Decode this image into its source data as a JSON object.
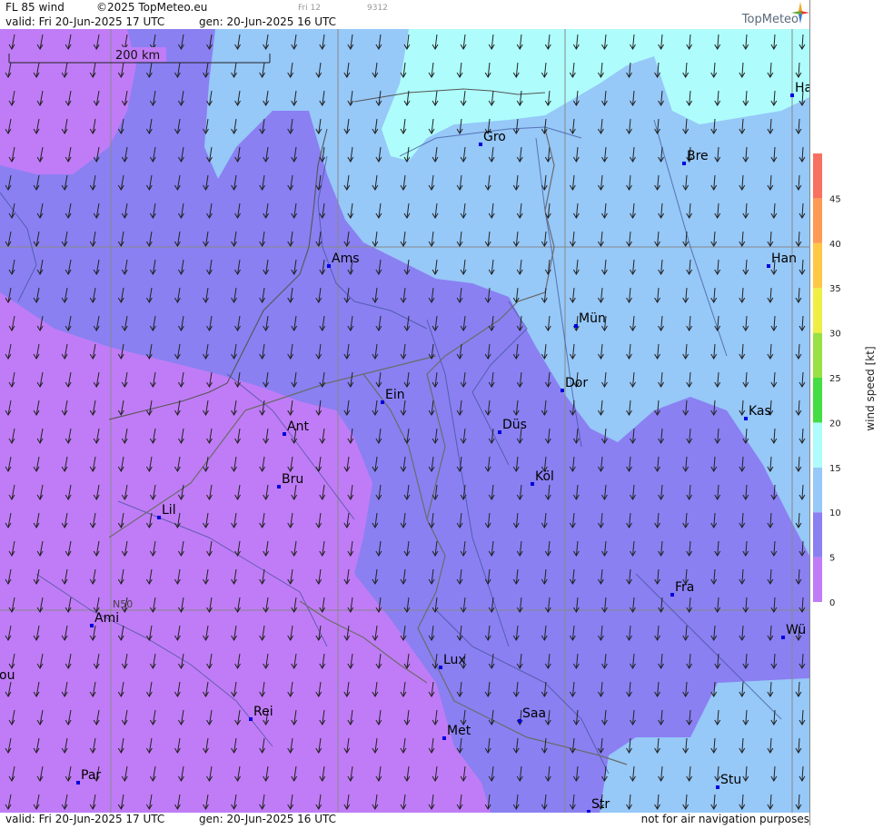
{
  "header": {
    "product": "FL 85 wind",
    "copyright": "©2025 TopMeteo.eu",
    "valid": "valid:  Fri  20-Jun-2025  17 UTC",
    "generated": "gen: 20-Jun-2025 16 UTC",
    "small_day": "Fri 12",
    "small_code": "9312",
    "logo": "TopMeteo"
  },
  "footer": {
    "valid": "valid:  Fri  20-Jun-2025  17 UTC",
    "generated": "gen: 20-Jun-2025 16 UTC",
    "disclaimer": "not for air navigation purposes"
  },
  "map": {
    "scale_label": "200 km",
    "graticule_label": "N50",
    "cities": [
      {
        "name": "Gro"
      },
      {
        "name": "Bre"
      },
      {
        "name": "Ha"
      },
      {
        "name": "Ams"
      },
      {
        "name": "Han"
      },
      {
        "name": "Mün"
      },
      {
        "name": "Dor"
      },
      {
        "name": "Ein"
      },
      {
        "name": "Kas"
      },
      {
        "name": "Ant"
      },
      {
        "name": "Düs"
      },
      {
        "name": "Bru"
      },
      {
        "name": "Köl"
      },
      {
        "name": "Lil"
      },
      {
        "name": "Fra"
      },
      {
        "name": "Ami"
      },
      {
        "name": "Wü"
      },
      {
        "name": "ou"
      },
      {
        "name": "Lux"
      },
      {
        "name": "Rei"
      },
      {
        "name": "Saa"
      },
      {
        "name": "Met"
      },
      {
        "name": "Stu"
      },
      {
        "name": "Par"
      },
      {
        "name": "Str"
      }
    ],
    "colors": {
      "0_5": "#c07cf6",
      "5_10": "#8a80f2",
      "10_15": "#96c8f8",
      "15_20": "#aefcfc"
    }
  },
  "legend": {
    "title": "wind  speed  [kt]",
    "ticks": [
      "0",
      "5",
      "10",
      "15",
      "20",
      "25",
      "30",
      "35",
      "40",
      "45"
    ],
    "colors": [
      "#c07cf6",
      "#8a80f2",
      "#96c8f8",
      "#aefcfc",
      "#44dd44",
      "#99e044",
      "#eeee44",
      "#ffc844",
      "#ff9a55",
      "#f87060"
    ]
  }
}
